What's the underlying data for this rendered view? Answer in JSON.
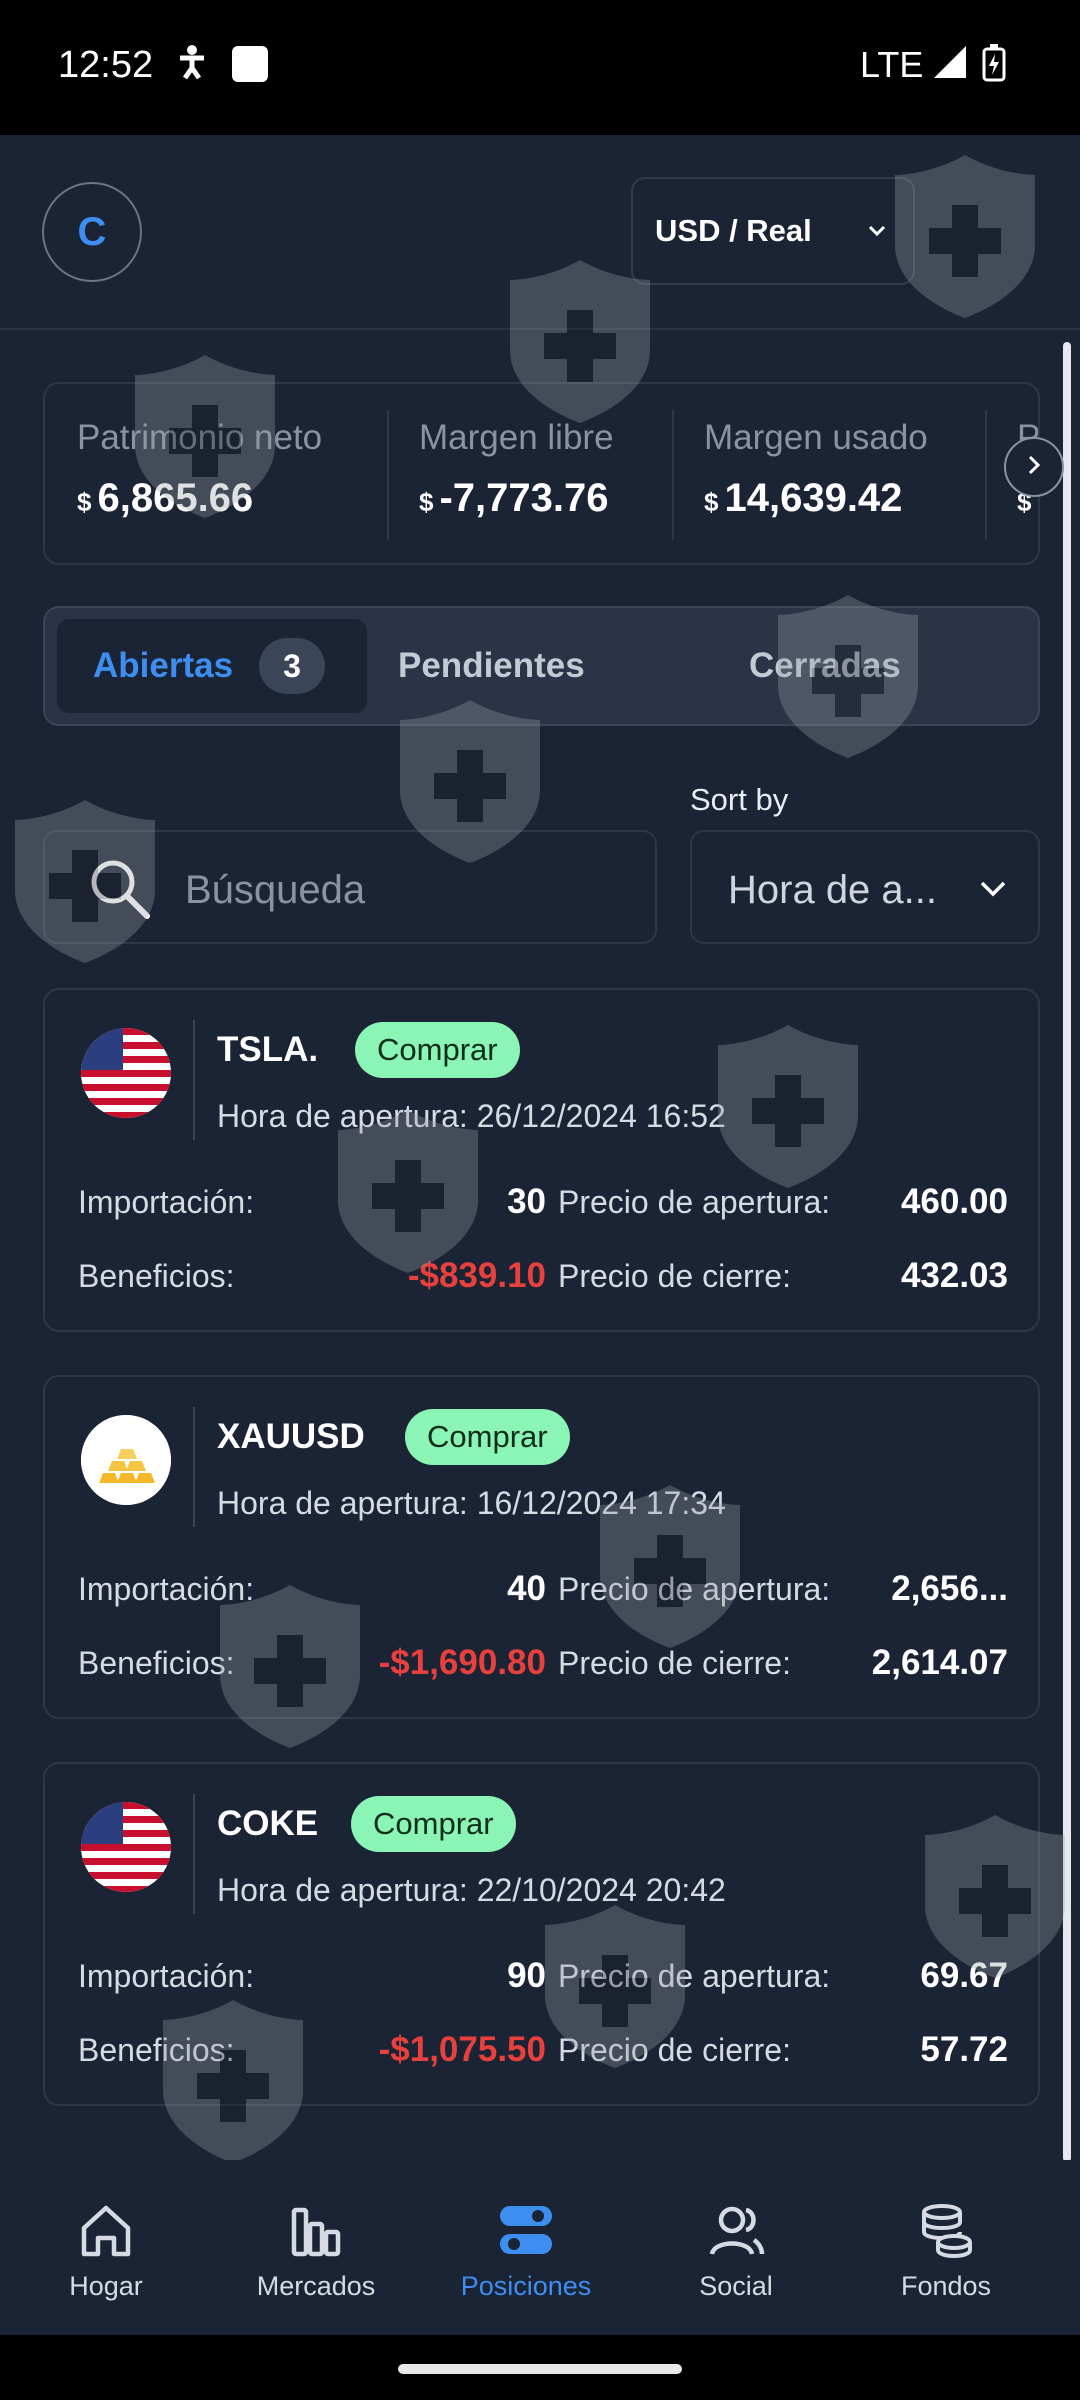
{
  "status_bar": {
    "time": "12:52",
    "network": "LTE"
  },
  "header": {
    "avatar_letter": "C",
    "account_select": "USD / Real"
  },
  "metrics": [
    {
      "label": "Patrimonio neto",
      "currency": "$",
      "value": "6,865.66"
    },
    {
      "label": "Margen libre",
      "currency": "$",
      "value": "-7,773.76"
    },
    {
      "label": "Margen usado",
      "currency": "$",
      "value": "14,639.42"
    },
    {
      "label": "P",
      "currency": "$",
      "value": ""
    }
  ],
  "tabs": {
    "open": {
      "label": "Abiertas",
      "count": "3"
    },
    "pending": {
      "label": "Pendientes"
    },
    "closed": {
      "label": "Cerradas"
    }
  },
  "search": {
    "placeholder": "Búsqueda"
  },
  "sort": {
    "label": "Sort by",
    "value": "Hora de a..."
  },
  "positions": [
    {
      "symbol": "TSLA.",
      "side": "Comprar",
      "flag": "us-flag",
      "open_time": "Hora de apertura: 26/12/2024 16:52",
      "import_label": "Importación:",
      "import_value": "30",
      "profit_label": "Beneficios:",
      "profit_value": "-$839.10",
      "open_price_label": "Precio de apertura:",
      "open_price_value": "460.00",
      "close_price_label": "Precio de cierre:",
      "close_price_value": "432.03"
    },
    {
      "symbol": "XAUUSD",
      "side": "Comprar",
      "flag": "gold-icon",
      "open_time": "Hora de apertura: 16/12/2024 17:34",
      "import_label": "Importación:",
      "import_value": "40",
      "profit_label": "Beneficios:",
      "profit_value": "-$1,690.80",
      "open_price_label": "Precio de apertura:",
      "open_price_value": "2,656...",
      "close_price_label": "Precio de cierre:",
      "close_price_value": "2,614.07"
    },
    {
      "symbol": "COKE",
      "side": "Comprar",
      "flag": "us-flag",
      "open_time": "Hora de apertura: 22/10/2024 20:42",
      "import_label": "Importación:",
      "import_value": "90",
      "profit_label": "Beneficios:",
      "profit_value": "-$1,075.50",
      "open_price_label": "Precio de apertura:",
      "open_price_value": "69.67",
      "close_price_label": "Precio de cierre:",
      "close_price_value": "57.72"
    }
  ],
  "bottom_nav": [
    {
      "label": "Hogar",
      "icon": "home-icon"
    },
    {
      "label": "Mercados",
      "icon": "markets-icon"
    },
    {
      "label": "Posiciones",
      "icon": "positions-icon",
      "active": true
    },
    {
      "label": "Social",
      "icon": "social-icon"
    },
    {
      "label": "Fondos",
      "icon": "funds-icon"
    }
  ],
  "colors": {
    "background": "#1b2434",
    "accent": "#3d8ef0",
    "negative": "#e8403c",
    "buy_pill": "#8af5b5"
  }
}
